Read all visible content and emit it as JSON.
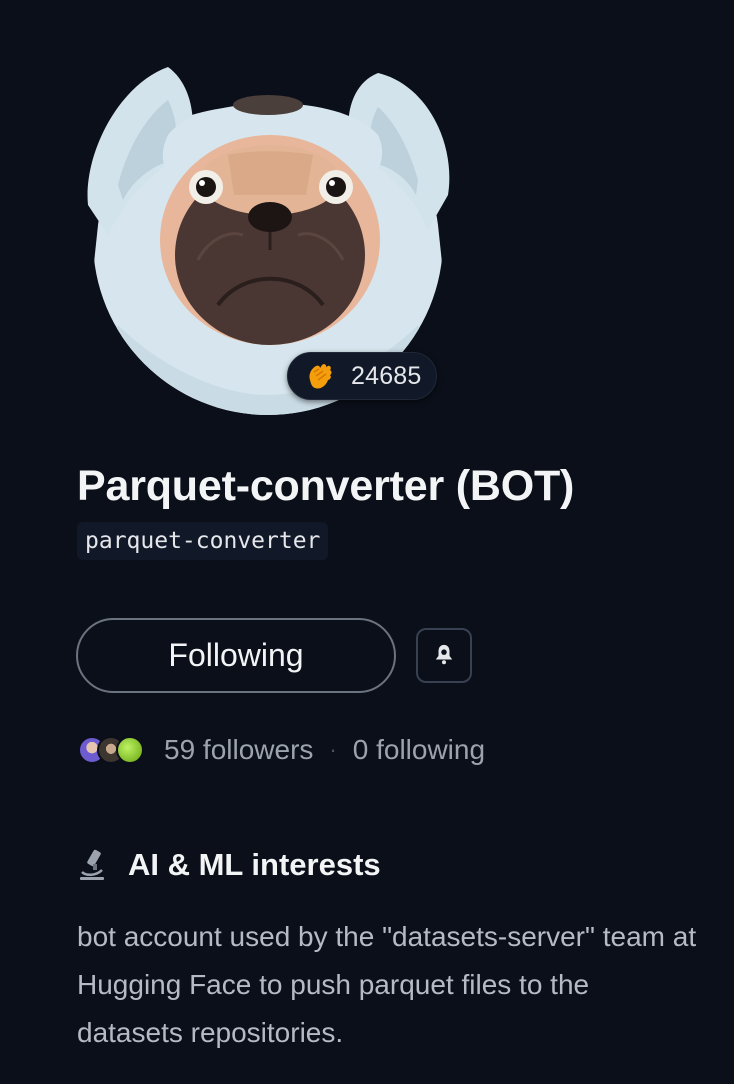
{
  "profile": {
    "display_name": "Parquet-converter (BOT)",
    "username": "parquet-converter",
    "reaction_count": "24685",
    "avatar_icon": "pug-in-bunny-costume-avatar",
    "reaction_icon": "clapping-hands-icon"
  },
  "actions": {
    "follow_label": "Following",
    "notify_icon": "bell-icon"
  },
  "stats": {
    "followers": "59 followers",
    "separator": "·",
    "following": "0 following",
    "follower_avatar_colors": [
      "#6d5bd0",
      "#5b4b3a",
      "#84cc16"
    ]
  },
  "interests": {
    "title": "AI & ML interests",
    "icon": "microscope-icon",
    "description": "bot account used by the \"datasets-server\" team at Hugging Face to push parquet files to the datasets repositories."
  },
  "theme": {
    "background": "#0b0f19",
    "text": "#e5e7eb",
    "muted": "#9ca3af"
  }
}
